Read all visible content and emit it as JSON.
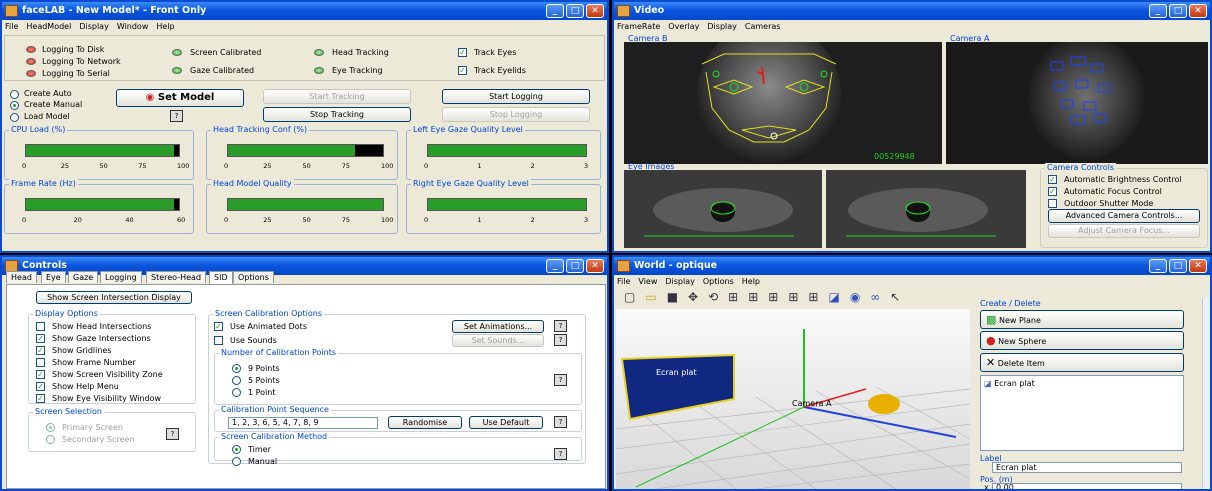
{
  "facelab": {
    "title": "faceLAB - New Model* - Front Only",
    "menu": [
      "File",
      "HeadModel",
      "Display",
      "Window",
      "Help"
    ],
    "leds": [
      "Logging To Disk",
      "Logging To Network",
      "Logging To Serial",
      "Screen Calibrated",
      "Gaze Calibrated",
      "Head Tracking",
      "Eye Tracking"
    ],
    "checks": [
      "Track Eyes",
      "Track Eyelids"
    ],
    "radios": [
      "Create Auto",
      "Create Manual",
      "Load Model"
    ],
    "set_model": "Set Model",
    "start_tracking": "Start Tracking",
    "stop_tracking": "Stop Tracking",
    "start_logging": "Start Logging",
    "stop_logging": "Stop Logging",
    "gauges": [
      {
        "label": "CPU Load (%)",
        "ticks": [
          "0",
          "25",
          "50",
          "75",
          "100"
        ],
        "value": 0.97
      },
      {
        "label": "Head Tracking Conf (%)",
        "ticks": [
          "0",
          "25",
          "50",
          "75",
          "100"
        ],
        "value": 0.82
      },
      {
        "label": "Left Eye Gaze Quality Level",
        "ticks": [
          "0",
          "1",
          "2",
          "3"
        ],
        "value": 1.0
      },
      {
        "label": "Frame Rate (Hz)",
        "ticks": [
          "0",
          "20",
          "40",
          "60"
        ],
        "value": 0.97
      },
      {
        "label": "Head Model Quality",
        "ticks": [
          "0",
          "25",
          "50",
          "75",
          "100"
        ],
        "value": 1.0
      },
      {
        "label": "Right Eye Gaze Quality Level",
        "ticks": [
          "0",
          "1",
          "2",
          "3"
        ],
        "value": 1.0
      }
    ]
  },
  "video": {
    "title": "Video",
    "menu": [
      "FrameRate",
      "Overlay",
      "Display",
      "Cameras"
    ],
    "cam_b": "Camera B",
    "cam_a": "Camera A",
    "frame": "00529948",
    "eye_images": "Eye Images",
    "camera_controls": "Camera Controls",
    "cc": [
      "Automatic Brightness Control",
      "Automatic Focus Control",
      "Outdoor Shutter Mode"
    ],
    "advanced": "Advanced Camera Controls...",
    "adjust": "Adjust Camera Focus..."
  },
  "controls": {
    "title": "Controls",
    "tabs": [
      "Head",
      "Eye",
      "Gaze",
      "Logging",
      "Stereo-Head",
      "SID",
      "Options"
    ],
    "show_screen": "Show Screen Intersection Display",
    "display_options": "Display Options",
    "disp": [
      "Show Head Intersections",
      "Show Gaze Intersections",
      "Show Gridlines",
      "Show Frame Number",
      "Show Screen Visibility Zone",
      "Show Help Menu",
      "Show Eye Visibility Window"
    ],
    "screen_selection": "Screen Selection",
    "primary": "Primary Screen",
    "secondary": "Secondary Screen",
    "calib_options": "Screen Calibration Options",
    "animated": "Use Animated Dots",
    "sounds": "Use Sounds",
    "set_anim": "Set Animations...",
    "set_sounds": "Set Sounds...",
    "num_points": "Number of Calibration Points",
    "points": [
      "9 Points",
      "5 Points",
      "1 Point"
    ],
    "sequence": "Calibration Point Sequence",
    "seq_value": "1, 2, 3, 6, 5, 4, 7, 8, 9",
    "randomise": "Randomise",
    "use_default": "Use Default",
    "method": "Screen Calibration Method",
    "methods": [
      "Timer",
      "Manual"
    ]
  },
  "world": {
    "title": "World - optique",
    "menu": [
      "File",
      "View",
      "Display",
      "Options",
      "Help"
    ],
    "create_delete": "Create / Delete",
    "new_plane": "New Plane",
    "new_sphere": "New Sphere",
    "delete_item": "Delete Item",
    "item": "Ecran plat",
    "plane_label": "Ecran plat",
    "camera_label": "Camera A",
    "label": "Label",
    "label_value": "Ecran plat",
    "pos": "Pos. (m)",
    "x_label": "x",
    "x_value": "0.00"
  }
}
